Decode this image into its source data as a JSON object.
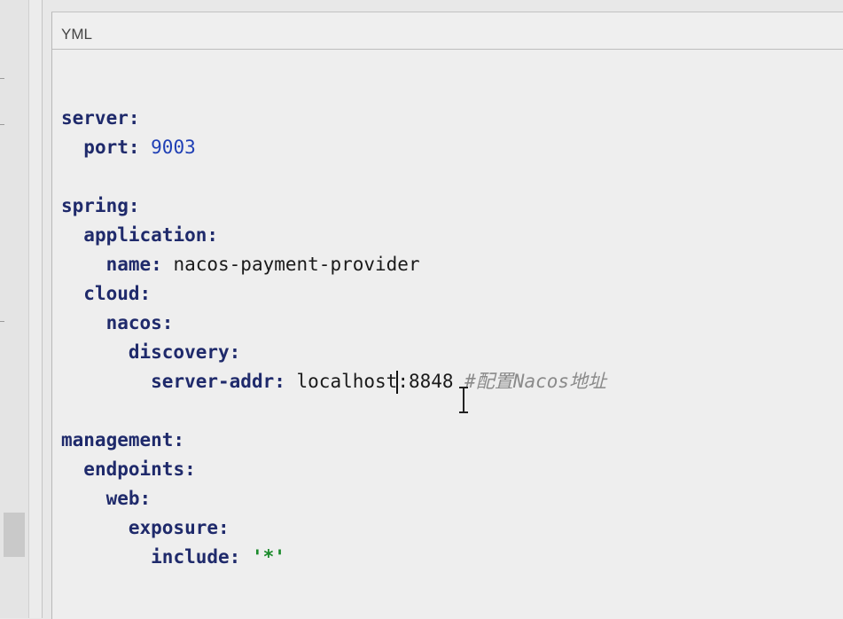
{
  "panel": {
    "title": "YML"
  },
  "code": {
    "lines": [
      {
        "indent": "",
        "key": "server:",
        "rest": []
      },
      {
        "indent": "  ",
        "key": "port:",
        "rest": [
          {
            "cls": "num",
            "text": " 9003"
          }
        ]
      },
      {
        "blank": true
      },
      {
        "indent": "",
        "key": "spring:",
        "rest": []
      },
      {
        "indent": "  ",
        "key": "application:",
        "rest": []
      },
      {
        "indent": "    ",
        "key": "name:",
        "rest": [
          {
            "cls": "plain",
            "text": " nacos-payment-provider"
          }
        ]
      },
      {
        "indent": "  ",
        "key": "cloud:",
        "rest": []
      },
      {
        "indent": "    ",
        "key": "nacos:",
        "rest": []
      },
      {
        "indent": "      ",
        "key": "discovery:",
        "rest": []
      },
      {
        "indent": "        ",
        "key": "server-addr:",
        "rest": [
          {
            "cls": "plain",
            "text": " localhost"
          },
          {
            "cls": "caret"
          },
          {
            "cls": "plain",
            "text": ":8848 "
          },
          {
            "cls": "cmt",
            "text": "#配置Nacos地址"
          }
        ]
      },
      {
        "blank": true
      },
      {
        "indent": "",
        "key": "management:",
        "rest": []
      },
      {
        "indent": "  ",
        "key": "endpoints:",
        "rest": []
      },
      {
        "indent": "    ",
        "key": "web:",
        "rest": []
      },
      {
        "indent": "      ",
        "key": "exposure:",
        "rest": []
      },
      {
        "indent": "        ",
        "key": "include:",
        "rest": [
          {
            "cls": "str",
            "text": " '*'"
          }
        ]
      }
    ]
  },
  "colors": {
    "key": "#1f2a6b",
    "number": "#1f3fb5",
    "string": "#1a8a2a",
    "comment": "#8a8a8a"
  },
  "icons": {
    "cursor": "text-ibeam-cursor-icon"
  }
}
